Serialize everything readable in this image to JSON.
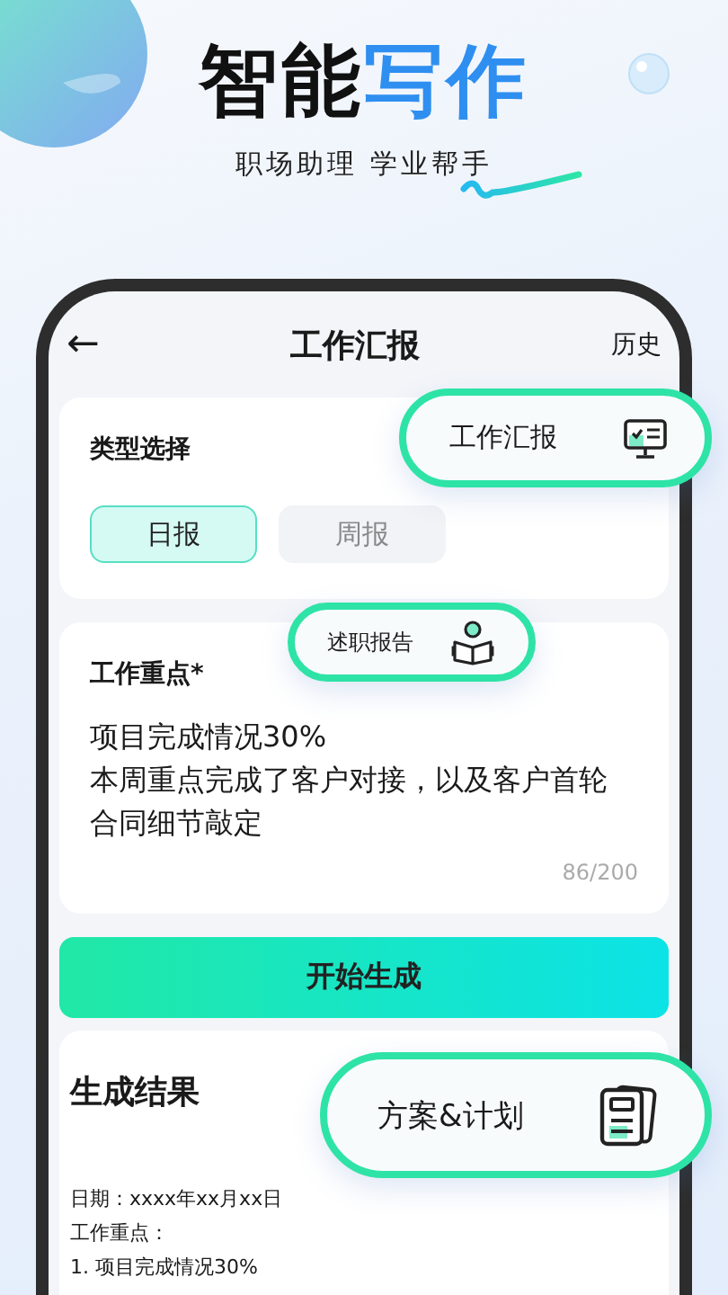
{
  "banner": {
    "title_dark": "智能",
    "title_accent": "写作",
    "subtitle": "职场助理 学业帮手"
  },
  "nav": {
    "back": "←",
    "title": "工作汇报",
    "action": "历史"
  },
  "type_section": {
    "label": "类型选择",
    "options": [
      {
        "label": "日报",
        "selected": true
      },
      {
        "label": "周报",
        "selected": false
      }
    ]
  },
  "focus_section": {
    "label": "工作重点*",
    "lines": [
      "项目完成情况30%",
      "本周重点完成了客户对接，以及客户首轮合同细节敲定"
    ],
    "counter": "86/200"
  },
  "generate_button": "开始生成",
  "result": {
    "title": "生成结果",
    "lines": [
      "日期：xxxx年xx月xx日",
      "工作重点：",
      "1. 项目完成情况30%"
    ]
  },
  "callouts": [
    {
      "label": "工作汇报",
      "kind": "monitor"
    },
    {
      "label": "述职报告",
      "kind": "reader"
    },
    {
      "label": "方案&计划",
      "kind": "document"
    }
  ]
}
